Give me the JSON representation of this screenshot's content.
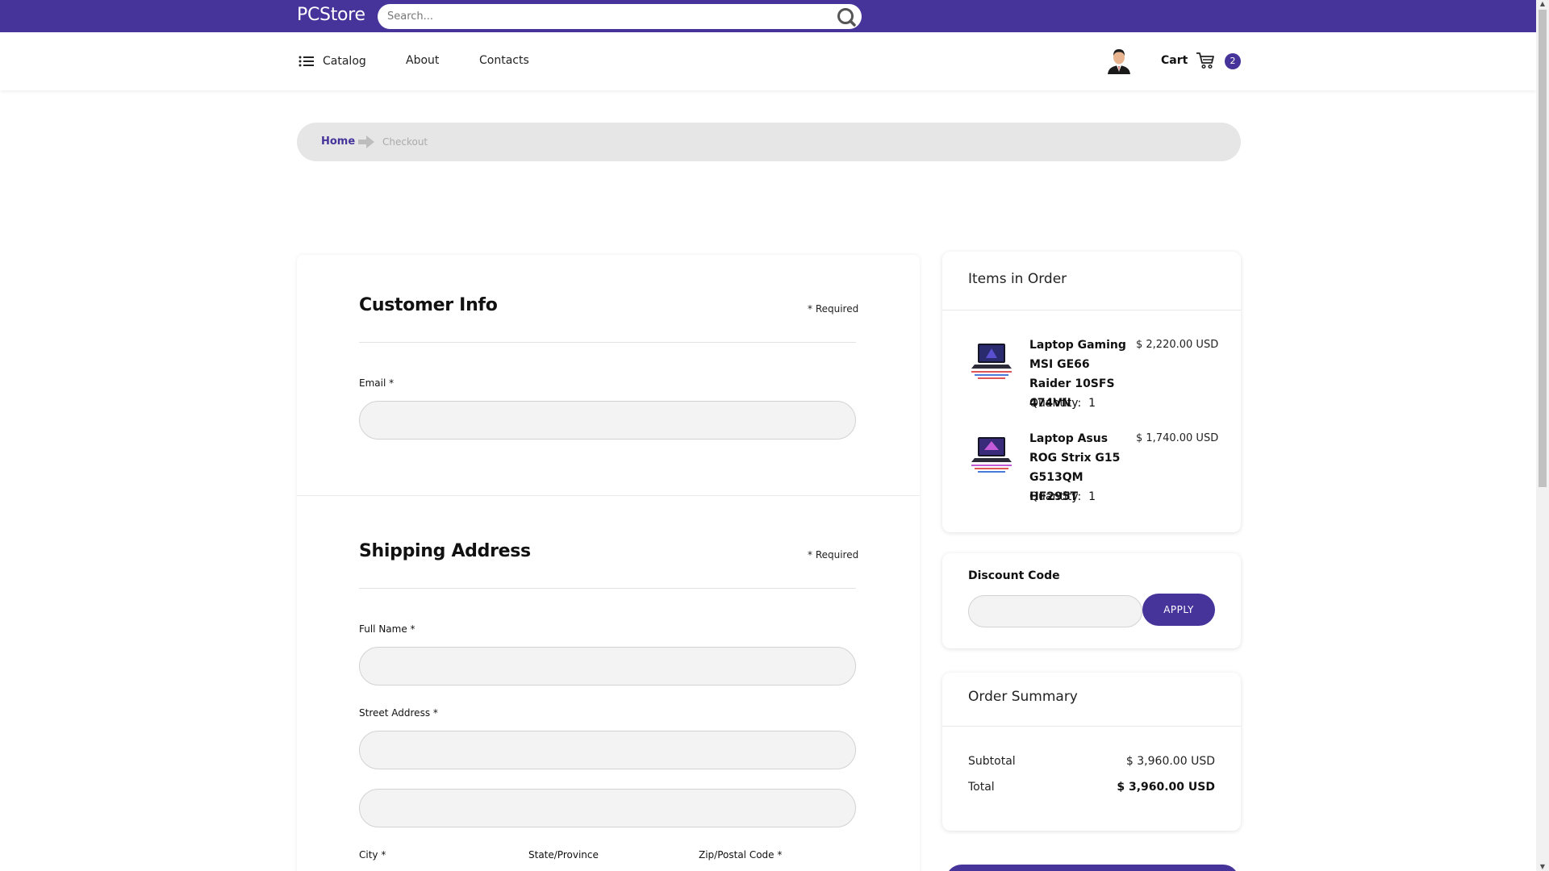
{
  "brand": {
    "logo": "PCStore",
    "accent": "#46349b"
  },
  "search": {
    "placeholder": "Search..."
  },
  "nav": {
    "catalog": "Catalog",
    "about": "About",
    "contacts": "Contacts",
    "cart_label": "Cart",
    "cart_count": "2"
  },
  "breadcrumb": {
    "home": "Home",
    "current": "Checkout"
  },
  "customer_info": {
    "title": "Customer Info",
    "required_note": "* Required",
    "email_label": "Email *"
  },
  "shipping": {
    "title": "Shipping Address",
    "required_note": "* Required",
    "full_name_label": "Full Name *",
    "street_label": "Street Address *",
    "city_label": "City *",
    "state_label": "State/Province",
    "zip_label": "Zip/Postal Code *"
  },
  "order_items": {
    "title": "Items in Order",
    "items": [
      {
        "name": "Laptop Gaming MSI GE66 Raider 10SFS 474VN",
        "price": "$ 2,220.00 USD",
        "quantity_label": "Quantity:",
        "quantity": "1"
      },
      {
        "name": "Laptop Asus ROG Strix G15 G513QM HF295T",
        "price": "$ 1,740.00 USD",
        "quantity_label": "Quantity:",
        "quantity": "1"
      }
    ]
  },
  "discount": {
    "label": "Discount Code",
    "apply": "APPLY",
    "value": ""
  },
  "summary": {
    "title": "Order Summary",
    "subtotal_label": "Subtotal",
    "subtotal": "$ 3,960.00 USD",
    "total_label": "Total",
    "total": "$ 3,960.00 USD"
  }
}
